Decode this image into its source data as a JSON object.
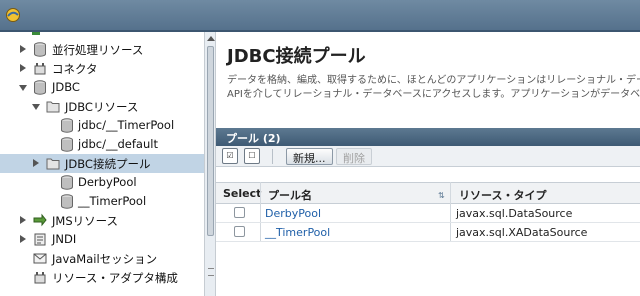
{
  "tree": {
    "items": [
      {
        "label": "並行処理リソース",
        "toggle": "collapsed",
        "icon": "database-icon"
      },
      {
        "label": "コネクタ",
        "toggle": "collapsed",
        "icon": "connector-icon"
      },
      {
        "label": "JDBC",
        "toggle": "expanded",
        "icon": "database-icon"
      },
      {
        "label": "JDBCリソース",
        "toggle": "expanded",
        "icon": "folder-icon"
      },
      {
        "label": "jdbc/__TimerPool",
        "toggle": "none",
        "icon": "database-icon"
      },
      {
        "label": "jdbc/__default",
        "toggle": "none",
        "icon": "database-icon"
      },
      {
        "label": "JDBC接続プール",
        "toggle": "collapsed",
        "icon": "folder-icon",
        "selected": true
      },
      {
        "label": "DerbyPool",
        "toggle": "none",
        "icon": "database-icon"
      },
      {
        "label": "__TimerPool",
        "toggle": "none",
        "icon": "database-icon"
      },
      {
        "label": "JMSリソース",
        "toggle": "collapsed",
        "icon": "jms-icon"
      },
      {
        "label": "JNDI",
        "toggle": "collapsed",
        "icon": "jndi-icon"
      },
      {
        "label": "JavaMailセッション",
        "toggle": "none",
        "icon": "mail-icon"
      },
      {
        "label": "リソース・アダプタ構成",
        "toggle": "none",
        "icon": "connector-icon"
      }
    ]
  },
  "main": {
    "title": "JDBC接続プール",
    "description_line1": "データを格納、編成、取得するために、ほとんどのアプリケーションはリレーショナル・デー",
    "description_line2": "APIを介してリレーショナル・データベースにアクセスします。アプリケーションがデータベー"
  },
  "table": {
    "title": "プール (2)",
    "toolbar": {
      "new_label": "新規...",
      "delete_label": "削除"
    },
    "columns": [
      "Select",
      "プール名",
      "リソース・タイプ"
    ],
    "rows": [
      {
        "pool_name": "DerbyPool",
        "resource_type": "javax.sql.DataSource"
      },
      {
        "pool_name": "__TimerPool",
        "resource_type": "javax.sql.XADataSource"
      }
    ]
  },
  "colors": {
    "header_bar": "#55718c",
    "link": "#1f5fa8",
    "selected_row": "#c1d4e5"
  }
}
